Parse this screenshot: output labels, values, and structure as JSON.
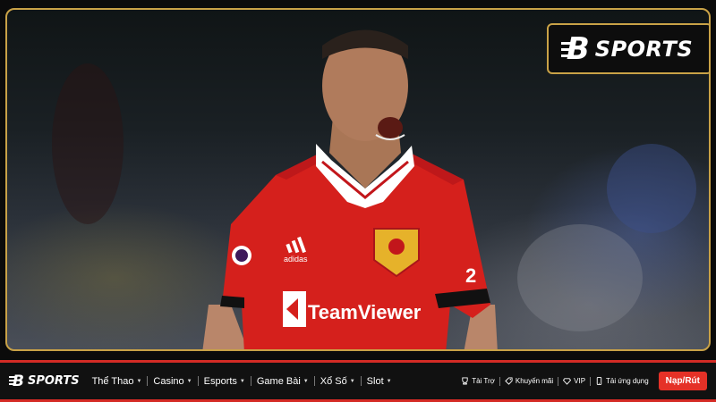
{
  "brand": {
    "logo_letter": "B",
    "name": "SPORTS"
  },
  "hero": {
    "jersey_sponsor": "TeamViewer",
    "kit_brand": "adidas",
    "accent_color": "#c9a247"
  },
  "nav": {
    "logo_letter": "B",
    "logo_text": "SPORTS",
    "menu": [
      {
        "label": "Thể Thao"
      },
      {
        "label": "Casino"
      },
      {
        "label": "Esports"
      },
      {
        "label": "Game Bài"
      },
      {
        "label": "Xổ Số"
      },
      {
        "label": "Slot"
      }
    ],
    "links": [
      {
        "label": "Tài Trợ",
        "icon": "trophy-icon"
      },
      {
        "label": "Khuyến mãi",
        "icon": "tag-icon"
      },
      {
        "label": "VIP",
        "icon": "diamond-icon"
      },
      {
        "label": "Tải ứng dụng",
        "icon": "phone-icon"
      }
    ],
    "cta_label": "Nạp/Rút",
    "colors": {
      "bar": "#111111",
      "border": "#d42b25",
      "cta": "#e53127"
    }
  }
}
